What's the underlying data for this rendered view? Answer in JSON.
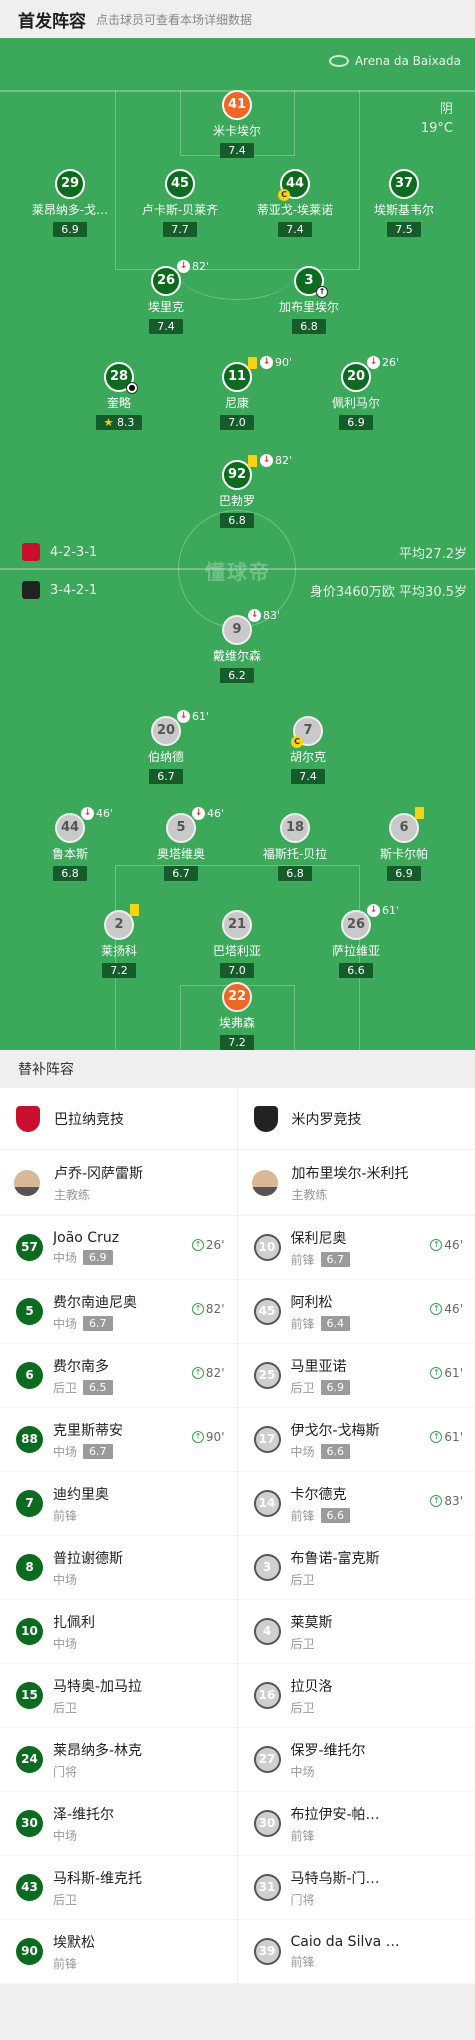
{
  "header": {
    "title": "首发阵容",
    "hint": "点击球员可查看本场详细数据"
  },
  "pitch": {
    "venue": "Arena da Baixada",
    "weather": "阴",
    "temperature": "19°C",
    "watermark": "懂球帝",
    "home": {
      "formation": "4-2-3-1",
      "info": "平均27.2岁"
    },
    "away": {
      "formation": "3-4-2-1",
      "info": "身价3460万欧 平均30.5岁"
    },
    "home_players": [
      {
        "num": "41",
        "name": "米卡埃尔",
        "rating": "7.4"
      },
      {
        "num": "29",
        "name": "莱昂纳多-戈…",
        "rating": "6.9"
      },
      {
        "num": "45",
        "name": "卢卡斯-贝莱齐",
        "rating": "7.7"
      },
      {
        "num": "44",
        "name": "蒂亚戈-埃莱诺",
        "rating": "7.4"
      },
      {
        "num": "37",
        "name": "埃斯基韦尔",
        "rating": "7.5"
      },
      {
        "num": "26",
        "name": "埃里克",
        "rating": "7.4",
        "sub": "82'"
      },
      {
        "num": "3",
        "name": "加布里埃尔",
        "rating": "6.8"
      },
      {
        "num": "28",
        "name": "奎略",
        "rating": "8.3"
      },
      {
        "num": "11",
        "name": "尼康",
        "rating": "7.0",
        "sub": "90'"
      },
      {
        "num": "20",
        "name": "佩利马尔",
        "rating": "6.9",
        "sub": "26'"
      },
      {
        "num": "92",
        "name": "巴勃罗",
        "rating": "6.8",
        "sub": "82'"
      }
    ],
    "away_players": [
      {
        "num": "9",
        "name": "戴维尔森",
        "rating": "6.2",
        "sub": "83'"
      },
      {
        "num": "20",
        "name": "伯纳德",
        "rating": "6.7",
        "sub": "61'"
      },
      {
        "num": "7",
        "name": "胡尔克",
        "rating": "7.4"
      },
      {
        "num": "44",
        "name": "鲁本斯",
        "rating": "6.8",
        "sub": "46'"
      },
      {
        "num": "5",
        "name": "奥塔维奥",
        "rating": "6.7",
        "sub": "46'"
      },
      {
        "num": "18",
        "name": "福斯托-贝拉",
        "rating": "6.8"
      },
      {
        "num": "6",
        "name": "斯卡尔帕",
        "rating": "6.9"
      },
      {
        "num": "2",
        "name": "莱扬科",
        "rating": "7.2"
      },
      {
        "num": "21",
        "name": "巴塔利亚",
        "rating": "7.0"
      },
      {
        "num": "26",
        "name": "萨拉维亚",
        "rating": "6.6",
        "sub": "61'"
      },
      {
        "num": "22",
        "name": "埃弗森",
        "rating": "7.2"
      }
    ]
  },
  "subs": {
    "title": "替补阵容",
    "home_team": "巴拉纳竞技",
    "away_team": "米内罗竞技",
    "home_coach": {
      "name": "卢乔-冈萨雷斯",
      "role": "主教练"
    },
    "away_coach": {
      "name": "加布里埃尔-米利托",
      "role": "主教练"
    },
    "home": [
      {
        "num": "57",
        "name": "João Cruz",
        "pos": "中场",
        "rating": "6.9",
        "in": "26'"
      },
      {
        "num": "5",
        "name": "费尔南迪尼奥",
        "pos": "中场",
        "rating": "6.7",
        "in": "82'"
      },
      {
        "num": "6",
        "name": "费尔南多",
        "pos": "后卫",
        "rating": "6.5",
        "in": "82'"
      },
      {
        "num": "88",
        "name": "克里斯蒂安",
        "pos": "中场",
        "rating": "6.7",
        "in": "90'"
      },
      {
        "num": "7",
        "name": "迪约里奥",
        "pos": "前锋"
      },
      {
        "num": "8",
        "name": "普拉谢德斯",
        "pos": "中场"
      },
      {
        "num": "10",
        "name": "扎佩利",
        "pos": "中场"
      },
      {
        "num": "15",
        "name": "马特奥-加马拉",
        "pos": "后卫"
      },
      {
        "num": "24",
        "name": "莱昂纳多-林克",
        "pos": "门将"
      },
      {
        "num": "30",
        "name": "泽-维托尔",
        "pos": "中场"
      },
      {
        "num": "43",
        "name": "马科斯-维克托",
        "pos": "后卫"
      },
      {
        "num": "90",
        "name": "埃默松",
        "pos": "前锋"
      }
    ],
    "away": [
      {
        "num": "10",
        "name": "保利尼奥",
        "pos": "前锋",
        "rating": "6.7",
        "in": "46'"
      },
      {
        "num": "45",
        "name": "阿利松",
        "pos": "前锋",
        "rating": "6.4",
        "in": "46'"
      },
      {
        "num": "25",
        "name": "马里亚诺",
        "pos": "后卫",
        "rating": "6.9",
        "in": "61'"
      },
      {
        "num": "17",
        "name": "伊戈尔-戈梅斯",
        "pos": "中场",
        "rating": "6.6",
        "in": "61'"
      },
      {
        "num": "14",
        "name": "卡尔德克",
        "pos": "前锋",
        "rating": "6.6",
        "in": "83'"
      },
      {
        "num": "3",
        "name": "布鲁诺-富克斯",
        "pos": "后卫"
      },
      {
        "num": "4",
        "name": "莱莫斯",
        "pos": "后卫"
      },
      {
        "num": "16",
        "name": "拉贝洛",
        "pos": "后卫"
      },
      {
        "num": "27",
        "name": "保罗-维托尔",
        "pos": "中场"
      },
      {
        "num": "30",
        "name": "布拉伊安-帕…",
        "pos": "前锋"
      },
      {
        "num": "31",
        "name": "马特乌斯-门…",
        "pos": "门将"
      },
      {
        "num": "39",
        "name": "Caio da Silva …",
        "pos": "前锋"
      }
    ]
  }
}
